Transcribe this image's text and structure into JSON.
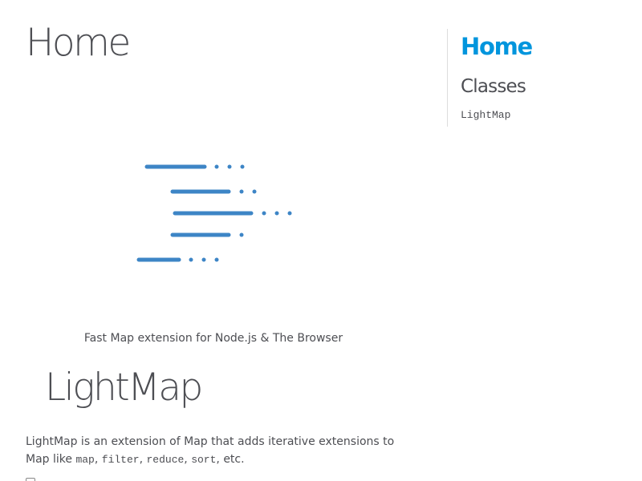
{
  "page": {
    "title": "Home",
    "tagline": "Fast Map extension for Node.js & The Browser"
  },
  "readme": {
    "title": "LightMap",
    "text_before": "LightMap is an extension of Map that adds iterative extensions to Map like ",
    "codes": [
      "map",
      "filter",
      "reduce",
      "sort"
    ],
    "separators": [
      ", ",
      ", ",
      ", ",
      ", etc."
    ]
  },
  "nav": {
    "home_label": "Home",
    "classes_heading": "Classes",
    "classes": [
      "LightMap"
    ]
  },
  "colors": {
    "accent": "#0095dd",
    "logo": "#3d85c6",
    "text": "#4d4e53"
  },
  "icons": {
    "logo": "speed-lines-logo-icon"
  }
}
